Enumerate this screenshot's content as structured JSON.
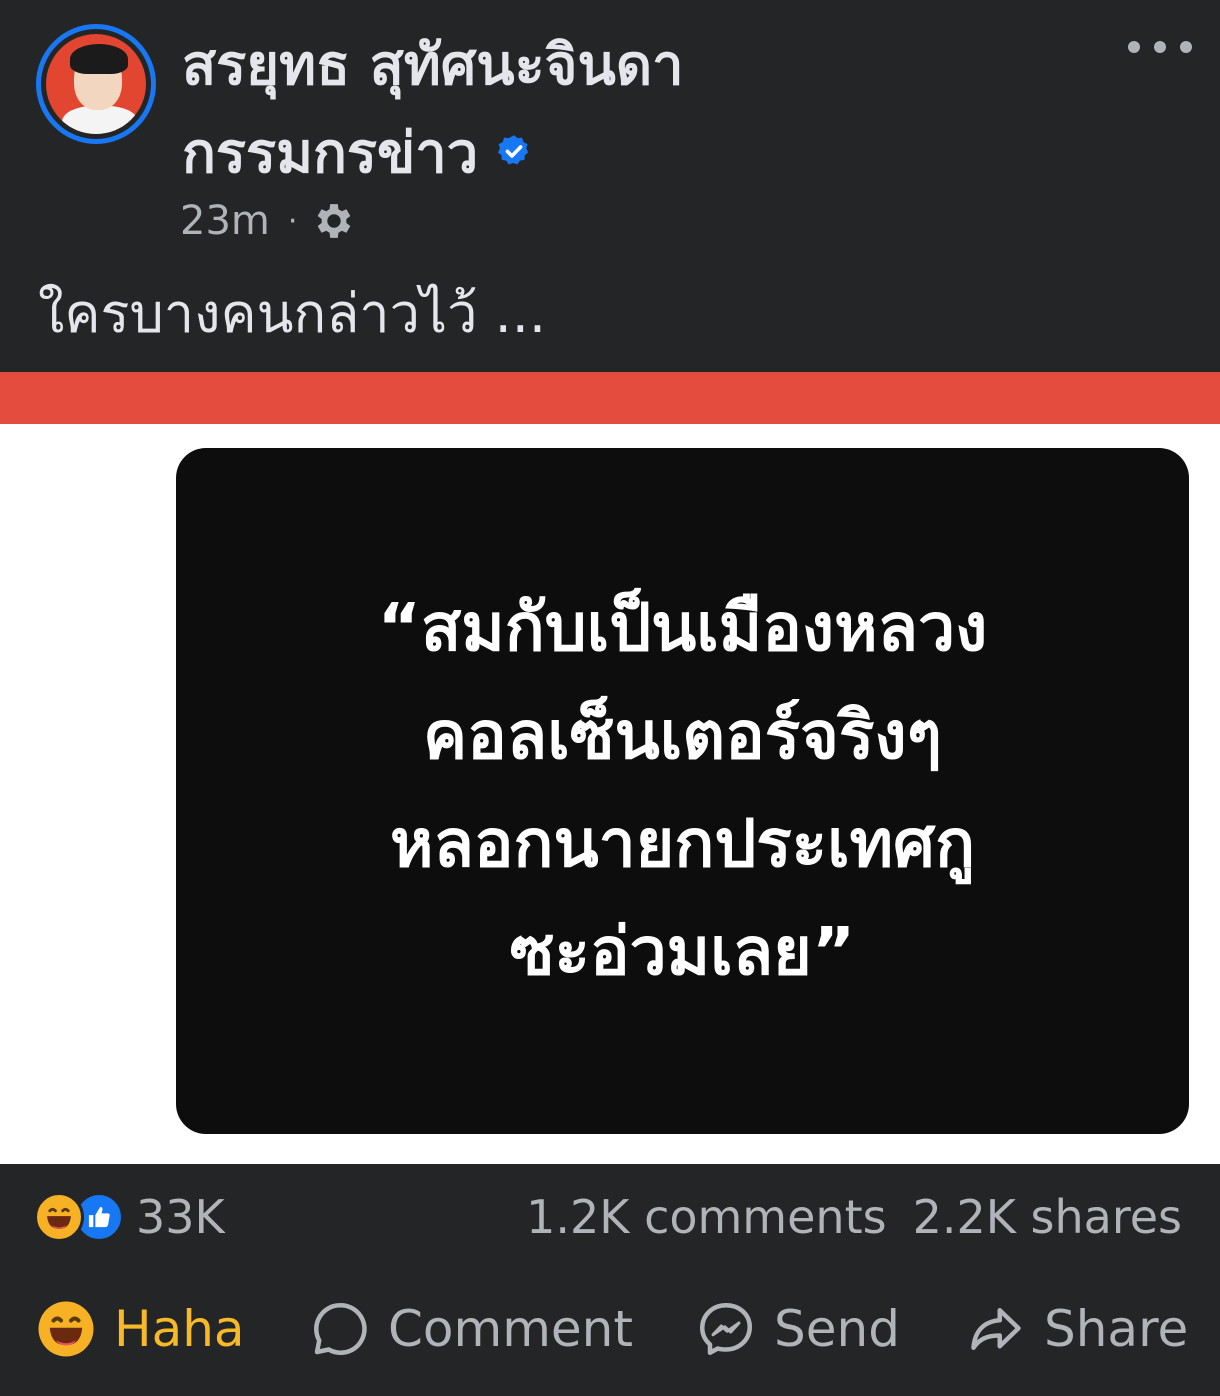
{
  "post": {
    "author_name_line1": "สรยุทธ สุทัศนะจินดา",
    "author_name_line2": "กรรมกรข่าว",
    "verified": true,
    "time": "23m",
    "privacy_icon": "gear-icon",
    "caption": "ใครบางคนกล่าวไว้ ...",
    "image_quote": [
      "“สมกับเป็นเมืองหลวง",
      "คอลเซ็นเตอร์จริงๆ",
      "หลอกนายกประเทศกู",
      "ซะอ่วมเลย”"
    ]
  },
  "stats": {
    "reaction_icons": [
      "haha-reaction-icon",
      "like-reaction-icon"
    ],
    "reaction_count": "33K",
    "comments": "1.2K comments",
    "shares": "2.2K shares"
  },
  "actions": {
    "haha_label": "Haha",
    "comment_label": "Comment",
    "send_label": "Send",
    "share_label": "Share"
  },
  "colors": {
    "background": "#242526",
    "text_primary": "#e4e6eb",
    "text_secondary": "#b0b3b8",
    "accent_blue": "#1877f2",
    "haha_yellow": "#f7b928",
    "image_red_band": "#e44d3d"
  }
}
